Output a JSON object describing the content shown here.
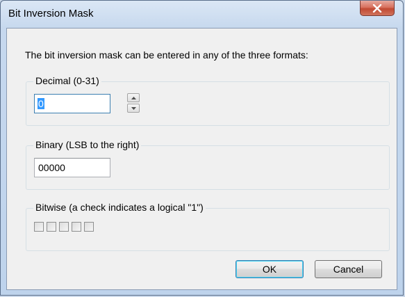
{
  "window": {
    "title": "Bit Inversion Mask",
    "close_icon": "close-x-icon"
  },
  "intro_text": "The bit inversion mask can be entered in any of the three formats:",
  "decimal": {
    "label": "Decimal (0-31)",
    "value": "0",
    "spinner_up_icon": "triangle-up-icon",
    "spinner_down_icon": "triangle-down-icon"
  },
  "binary": {
    "label": "Binary (LSB to the right)",
    "value": "00000"
  },
  "bitwise": {
    "label": "Bitwise (a check indicates a logical \"1\")",
    "bits": [
      false,
      false,
      false,
      false,
      false
    ]
  },
  "buttons": {
    "ok": "OK",
    "cancel": "Cancel"
  }
}
